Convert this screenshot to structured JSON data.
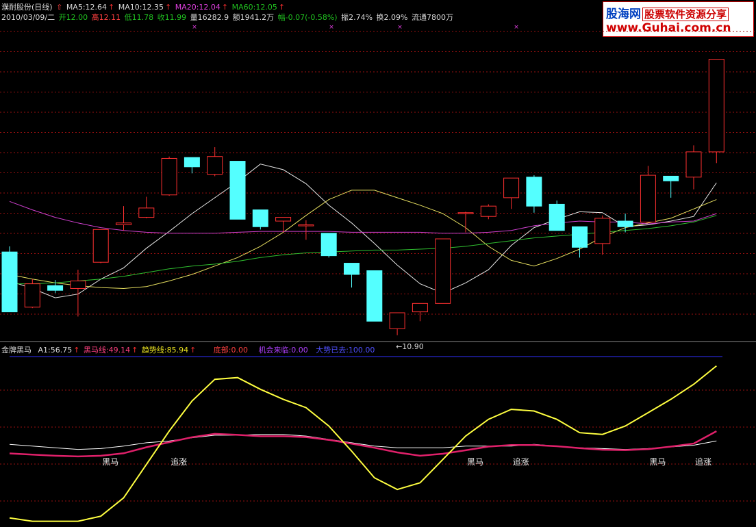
{
  "header": {
    "title": "濮耐股份(日线)",
    "ma5": "MA5:12.64",
    "ma10": "MA10:12.35",
    "ma20": "MA20:12.04",
    "ma60": "MA60:12.05",
    "date": "2010/03/09/二",
    "open": "开12.00",
    "high": "高12.11",
    "low": "低11.78",
    "close": "收11.99",
    "volume": "量16282.9",
    "amount": "额1941.2万",
    "change": "幅-0.07(-0.58%)",
    "amplitude": "振2.74%",
    "turnover": "换2.09%",
    "float": "流通7800万"
  },
  "watermark": {
    "line1": "股海网",
    "line1b": "股票软件资源分享",
    "line2": "www.Guhai.com.cn"
  },
  "indicator": {
    "name": "金牌黑马",
    "a1": "A1:56.75",
    "heima": "黑马线:49.14",
    "qushi": "趋势线:85.94",
    "dibu": "底部:0.00",
    "jihui": "机会来临:0.00",
    "dashi": "大势已去:100.00"
  },
  "annotations": {
    "low_label": "←10.90"
  },
  "colors": {
    "up": "#ff3030",
    "down": "#54ffff",
    "ma5": "#e8e8e8",
    "ma10": "#e8e060",
    "ma20": "#d040d0",
    "ma60": "#30c030",
    "grid": "#9a1010",
    "yellow": "#ffff40",
    "crimson": "#e0206a"
  },
  "chart_data": [
    {
      "type": "candlestick",
      "title": "濮耐股份(日线)",
      "series": [
        {
          "name": "candles",
          "values": [
            {
              "o": 11.79,
              "h": 11.85,
              "l": 11.16,
              "c": 11.15
            },
            {
              "o": 11.2,
              "h": 11.5,
              "l": 11.19,
              "c": 11.45
            },
            {
              "o": 11.43,
              "h": 11.49,
              "l": 11.35,
              "c": 11.38
            },
            {
              "o": 11.4,
              "h": 11.6,
              "l": 11.1,
              "c": 11.48
            },
            {
              "o": 11.68,
              "h": 12.03,
              "l": 11.67,
              "c": 12.03
            },
            {
              "o": 12.08,
              "h": 12.28,
              "l": 12.02,
              "c": 12.1
            },
            {
              "o": 12.16,
              "h": 12.38,
              "l": 12.15,
              "c": 12.26
            },
            {
              "o": 12.4,
              "h": 12.81,
              "l": 12.39,
              "c": 12.79
            },
            {
              "o": 12.8,
              "h": 12.75,
              "l": 12.63,
              "c": 12.7
            },
            {
              "o": 12.62,
              "h": 12.91,
              "l": 12.6,
              "c": 12.81
            },
            {
              "o": 12.76,
              "h": 12.76,
              "l": 12.24,
              "c": 12.14
            },
            {
              "o": 12.24,
              "h": 12.24,
              "l": 12.03,
              "c": 12.06
            },
            {
              "o": 12.12,
              "h": 12.15,
              "l": 12.0,
              "c": 12.16
            },
            {
              "o": 12.07,
              "h": 12.13,
              "l": 11.92,
              "c": 12.08
            },
            {
              "o": 11.99,
              "h": 11.99,
              "l": 11.73,
              "c": 11.75
            },
            {
              "o": 11.67,
              "h": 11.67,
              "l": 11.41,
              "c": 11.55
            },
            {
              "o": 11.59,
              "h": 11.59,
              "l": 11.05,
              "c": 11.05
            },
            {
              "o": 10.97,
              "h": 11.1,
              "l": 10.9,
              "c": 11.14
            },
            {
              "o": 11.15,
              "h": 11.24,
              "l": 11.05,
              "c": 11.24
            },
            {
              "o": 11.24,
              "h": 11.83,
              "l": 11.24,
              "c": 11.93
            },
            {
              "o": 12.2,
              "h": 12.22,
              "l": 12.0,
              "c": 12.21
            },
            {
              "o": 12.17,
              "h": 12.3,
              "l": 12.14,
              "c": 12.28
            },
            {
              "o": 12.37,
              "h": 12.56,
              "l": 12.25,
              "c": 12.58
            },
            {
              "o": 12.59,
              "h": 12.61,
              "l": 12.21,
              "c": 12.28
            },
            {
              "o": 12.3,
              "h": 12.34,
              "l": 12.02,
              "c": 12.02
            },
            {
              "o": 12.06,
              "h": 12.06,
              "l": 11.73,
              "c": 11.84
            },
            {
              "o": 11.88,
              "h": 12.18,
              "l": 11.76,
              "c": 12.15
            },
            {
              "o": 12.12,
              "h": 12.2,
              "l": 12.0,
              "c": 12.06
            },
            {
              "o": 12.11,
              "h": 12.71,
              "l": 12.11,
              "c": 12.61
            },
            {
              "o": 12.6,
              "h": 12.53,
              "l": 12.37,
              "c": 12.55
            },
            {
              "o": 12.59,
              "h": 12.93,
              "l": 12.46,
              "c": 12.86
            },
            {
              "o": 12.86,
              "h": 13.85,
              "l": 12.74,
              "c": 13.85
            }
          ]
        },
        {
          "name": "MA5",
          "values": [
            11.48,
            11.4,
            11.3,
            11.34,
            11.5,
            11.62,
            11.83,
            12.01,
            12.2,
            12.37,
            12.54,
            12.73,
            12.67,
            12.52,
            12.29,
            12.1,
            11.88,
            11.65,
            11.45,
            11.35,
            11.46,
            11.6,
            11.86,
            12.05,
            12.14,
            12.22,
            12.21,
            12.06,
            12.08,
            12.12,
            12.17,
            12.53
          ]
        },
        {
          "name": "MA10",
          "values": [
            11.55,
            11.5,
            11.46,
            11.43,
            11.41,
            11.4,
            11.42,
            11.48,
            11.55,
            11.64,
            11.73,
            11.85,
            12.0,
            12.18,
            12.35,
            12.45,
            12.45,
            12.37,
            12.29,
            12.2,
            12.05,
            11.85,
            11.7,
            11.64,
            11.72,
            11.82,
            11.95,
            12.05,
            12.1,
            12.15,
            12.25,
            12.35
          ]
        },
        {
          "name": "MA20",
          "values": [
            12.33,
            12.24,
            12.16,
            12.1,
            12.05,
            12.02,
            12.0,
            11.99,
            11.99,
            11.99,
            12.0,
            12.01,
            12.01,
            12.01,
            12.01,
            12.0,
            12.0,
            12.0,
            12.0,
            11.99,
            11.99,
            12.0,
            12.02,
            12.07,
            12.1,
            12.12,
            12.11,
            12.11,
            12.09,
            12.11,
            12.12,
            12.2
          ]
        },
        {
          "name": "MA60",
          "values": [
            11.45,
            11.45,
            11.46,
            11.48,
            11.5,
            11.53,
            11.57,
            11.61,
            11.64,
            11.66,
            11.69,
            11.73,
            11.76,
            11.78,
            11.79,
            11.8,
            11.81,
            11.81,
            11.82,
            11.83,
            11.85,
            11.88,
            11.91,
            11.94,
            11.96,
            11.98,
            12.0,
            12.02,
            12.04,
            12.07,
            12.11,
            12.18
          ]
        }
      ],
      "low_marker": {
        "index": 17,
        "value": 10.9,
        "label": "←10.90"
      },
      "ylim": [
        10.84,
        14.22
      ],
      "grid": true
    },
    {
      "type": "line",
      "title": "金牌黑马",
      "ylim": [
        0,
        100
      ],
      "series": [
        {
          "name": "A1",
          "values": [
            3,
            1,
            1,
            1,
            4,
            15,
            35,
            55,
            73,
            86,
            87,
            80,
            74,
            69,
            58,
            43,
            27,
            20,
            24,
            38,
            52,
            62,
            68,
            67,
            62,
            54,
            53,
            58,
            66,
            74,
            83,
            94
          ]
        },
        {
          "name": "黑马线",
          "values": [
            41.6,
            40.9,
            40.2,
            39.8,
            40.2,
            41.7,
            45.3,
            48.3,
            51.3,
            53.3,
            52.7,
            51.9,
            51.9,
            51.4,
            49.7,
            47.4,
            45.0,
            42.2,
            40.2,
            41.4,
            43.5,
            45.7,
            46.6,
            46.6,
            45.9,
            44.8,
            43.8,
            43.6,
            44.2,
            45.7,
            47.5,
            54.9
          ]
        },
        {
          "name": "趋势线",
          "values": [
            47,
            46,
            45,
            44,
            44.5,
            46,
            48,
            49,
            51,
            52.5,
            52.5,
            53,
            53,
            52,
            50,
            48,
            46,
            45,
            45,
            45,
            46,
            46,
            46,
            47,
            46,
            45,
            44.5,
            44,
            44.5,
            45.5,
            46.5,
            49.1
          ]
        }
      ],
      "labels": [
        {
          "text": "黑马",
          "index": 4
        },
        {
          "text": "追涨",
          "index": 7
        },
        {
          "text": "黑马",
          "index": 20
        },
        {
          "text": "追涨",
          "index": 22
        },
        {
          "text": "黑马",
          "index": 28
        },
        {
          "text": "追涨",
          "index": 30
        }
      ]
    }
  ]
}
